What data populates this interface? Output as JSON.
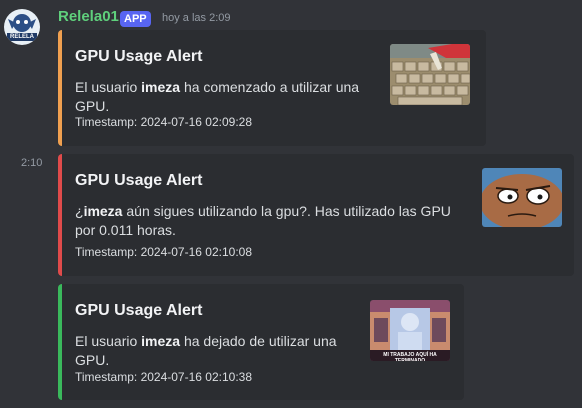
{
  "author": {
    "name": "Relela01",
    "badge": "APP",
    "timestamp": "hoy a las 2:09",
    "avatar_text": "RELELA"
  },
  "side_timestamp": "2:10",
  "embeds": [
    {
      "color": "#f0a050",
      "title": "GPU Usage Alert",
      "desc_pre": "El usuario ",
      "desc_user": "imeza",
      "desc_post": " ha comenzado a utilizar una GPU.",
      "footer": "Timestamp: 2024-07-16 02:09:28"
    },
    {
      "color": "#e04b4b",
      "title": "GPU Usage Alert",
      "desc_pre": "¿",
      "desc_user": "imeza",
      "desc_post": " aún sigues utilizando la gpu?. Has utilizado las GPU por 0.011 horas.",
      "footer": "Timestamp: 2024-07-16 02:10:08"
    },
    {
      "color": "#3ab95c",
      "title": "GPU Usage Alert",
      "desc_pre": "El usuario ",
      "desc_user": "imeza",
      "desc_post": " ha dejado de utilizar una GPU.",
      "footer": "Timestamp: 2024-07-16 02:10:38",
      "thumb_caption": "MI TRABAJO AQUÍ HA TERMINADO"
    }
  ]
}
